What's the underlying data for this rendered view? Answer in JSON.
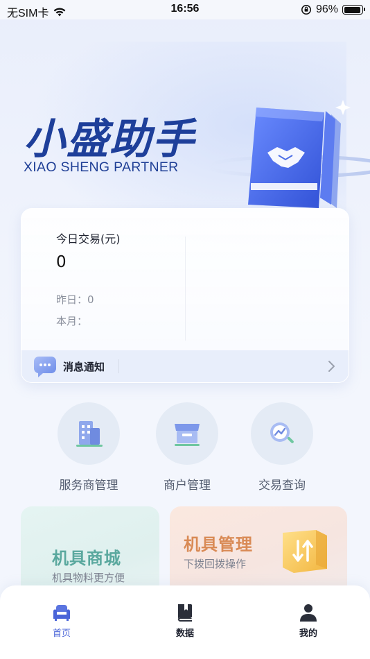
{
  "status_bar": {
    "carrier": "无SIM卡",
    "time": "16:56",
    "battery_percent": "96%",
    "battery_level": 0.96
  },
  "hero": {
    "title": "小盛助手",
    "subtitle": "XIAO SHENG PARTNER"
  },
  "today_card": {
    "title": "今日交易(元)",
    "value": "0",
    "yesterday": "昨日：0",
    "month": "本月："
  },
  "notice": {
    "label": "消息通知"
  },
  "functions": [
    {
      "label": "服务商管理",
      "icon": "building-icon"
    },
    {
      "label": "商户管理",
      "icon": "storefront-icon"
    },
    {
      "label": "交易查询",
      "icon": "magnifier-chart-icon"
    }
  ],
  "promos": {
    "mall": {
      "title": "机具商城",
      "subtitle": "机具物料更方便",
      "color": "#5aa89e"
    },
    "equipment": {
      "title": "机具管理",
      "subtitle": "下拨回拨操作",
      "color": "#d98a55"
    }
  },
  "tabbar": {
    "active_color": "#4a64d8",
    "items": [
      {
        "label": "首页",
        "icon": "sofa-icon"
      },
      {
        "label": "数据",
        "icon": "book-icon"
      },
      {
        "label": "我的",
        "icon": "person-icon"
      }
    ]
  }
}
